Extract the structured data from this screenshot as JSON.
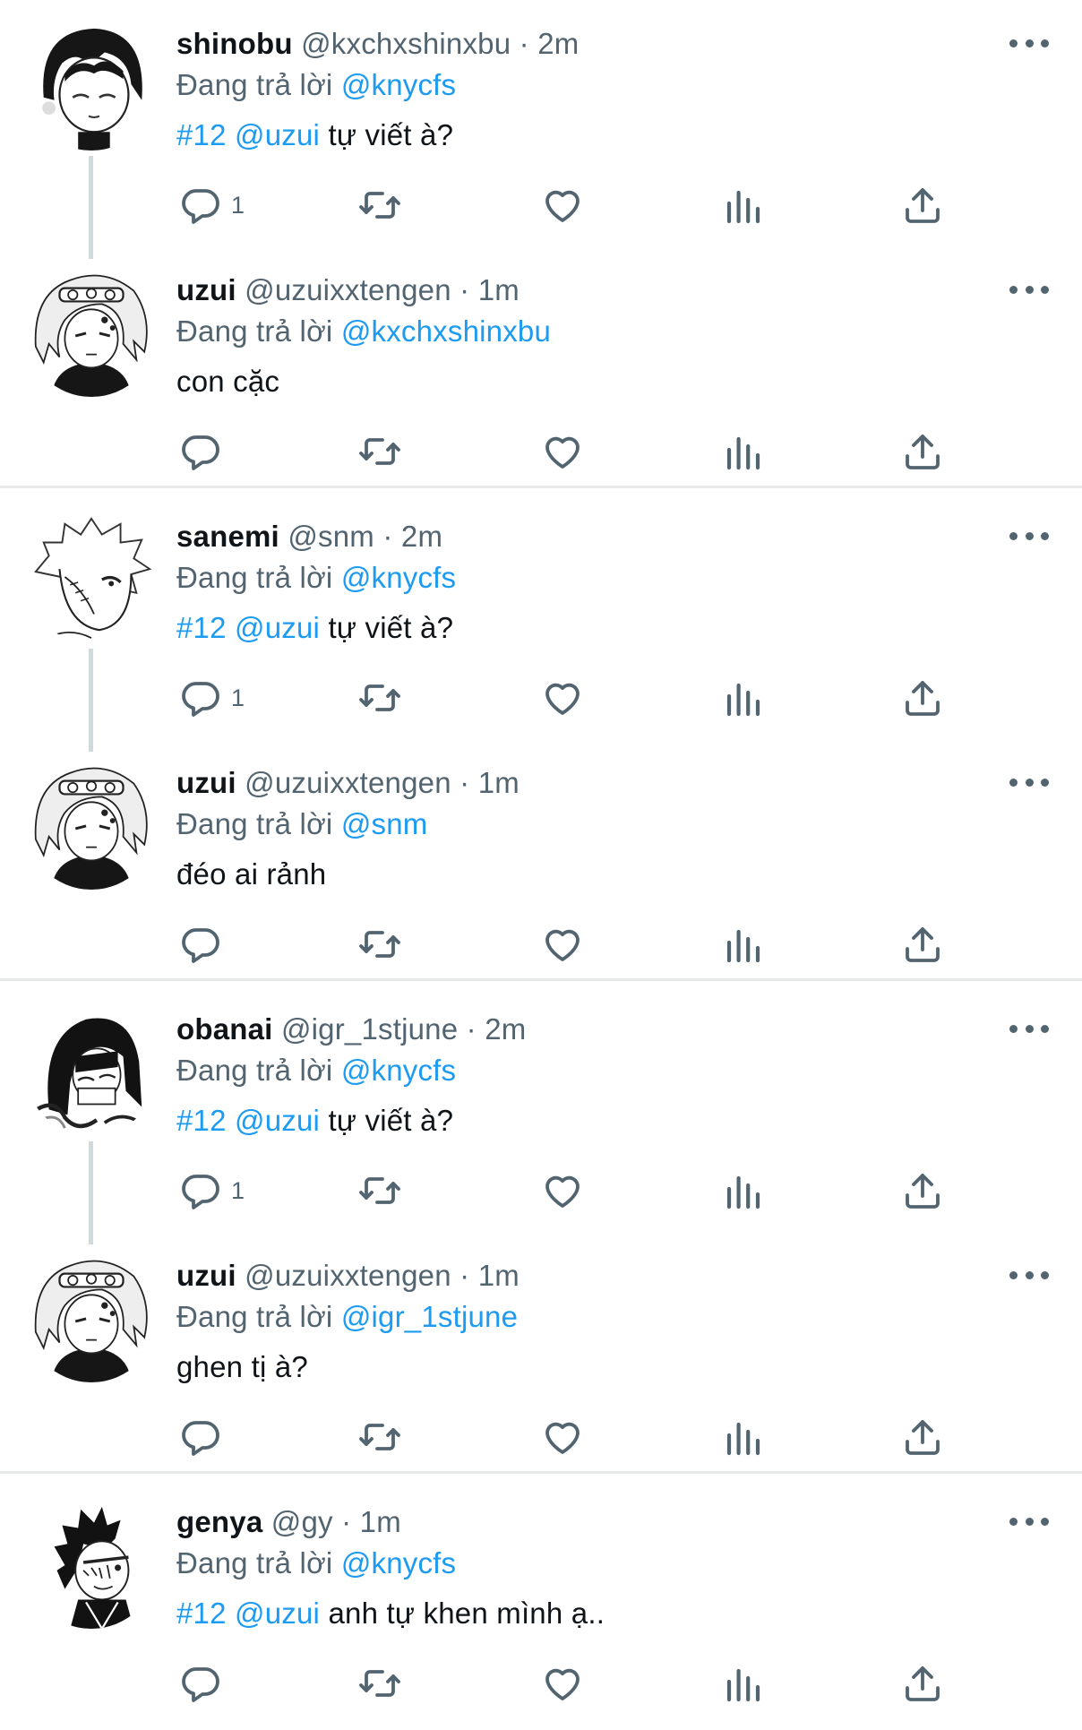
{
  "replying_prefix": "Đang trả lời",
  "separator": "·",
  "tweets": [
    {
      "name": "shinobu",
      "handle": "@kxchxshinxbu",
      "time": "2m",
      "reply_to": "@knycfs",
      "hashtag": "#12",
      "mention": "@uzui",
      "text": "tự viết à?",
      "reply_count": "1",
      "avatar": "shinobu-avatar"
    },
    {
      "name": "uzui",
      "handle": "@uzuixxtengen",
      "time": "1m",
      "reply_to": "@kxchxshinxbu",
      "text": "con cặc",
      "reply_count": "",
      "avatar": "uzui-avatar"
    },
    {
      "name": "sanemi",
      "handle": "@snm",
      "time": "2m",
      "reply_to": "@knycfs",
      "hashtag": "#12",
      "mention": "@uzui",
      "text": "tự viết à?",
      "reply_count": "1",
      "avatar": "sanemi-avatar"
    },
    {
      "name": "uzui",
      "handle": "@uzuixxtengen",
      "time": "1m",
      "reply_to": "@snm",
      "text": "đéo ai rảnh",
      "reply_count": "",
      "avatar": "uzui-avatar"
    },
    {
      "name": "obanai",
      "handle": "@igr_1stjune",
      "time": "2m",
      "reply_to": "@knycfs",
      "hashtag": "#12",
      "mention": "@uzui",
      "text": "tự viết à?",
      "reply_count": "1",
      "avatar": "obanai-avatar"
    },
    {
      "name": "uzui",
      "handle": "@uzuixxtengen",
      "time": "1m",
      "reply_to": "@igr_1stjune",
      "text": "ghen tị à?",
      "reply_count": "",
      "avatar": "uzui-avatar"
    },
    {
      "name": "genya",
      "handle": "@gy",
      "time": "1m",
      "reply_to": "@knycfs",
      "hashtag": "#12",
      "mention": "@uzui",
      "text": "anh tự khen mình ạ..",
      "reply_count": "",
      "avatar": "genya-avatar"
    }
  ],
  "colors": {
    "link": "#1d9bf0",
    "muted": "#536471",
    "text": "#0f1419",
    "divider": "#e7e9ea",
    "thread_line": "#cfd9de"
  },
  "icons": [
    "reply-icon",
    "retweet-icon",
    "like-icon",
    "views-icon",
    "share-icon",
    "more-icon"
  ]
}
